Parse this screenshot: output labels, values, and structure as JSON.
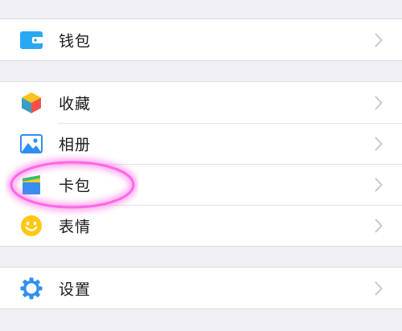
{
  "groups": [
    {
      "items": [
        {
          "label": "钱包",
          "icon": "wallet-icon"
        }
      ]
    },
    {
      "items": [
        {
          "label": "收藏",
          "icon": "favorites-cube-icon"
        },
        {
          "label": "相册",
          "icon": "album-picture-icon"
        },
        {
          "label": "卡包",
          "icon": "card-package-icon"
        },
        {
          "label": "表情",
          "icon": "smiley-face-icon"
        }
      ]
    },
    {
      "items": [
        {
          "label": "设置",
          "icon": "settings-gear-icon"
        }
      ]
    }
  ],
  "colors": {
    "background": "#efeff4",
    "wallet": "#2aa8f2",
    "highlight": "#ff3ddc"
  }
}
